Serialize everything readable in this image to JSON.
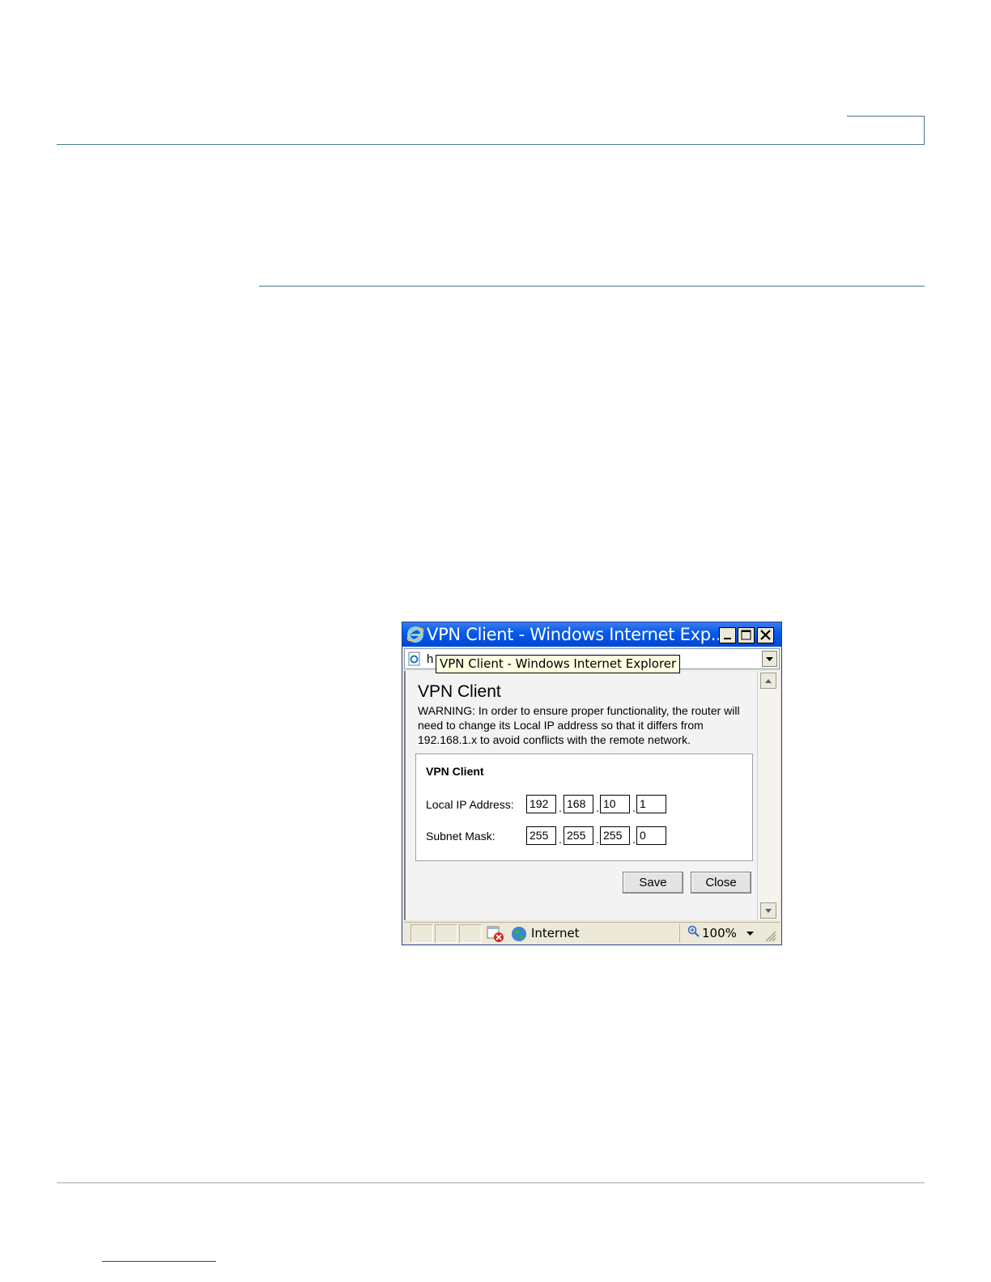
{
  "window": {
    "title": "VPN Client - Windows Internet Exp...",
    "tooltip": "VPN Client - Windows Internet Explorer",
    "address_prefix": "h"
  },
  "page": {
    "heading": "VPN Client",
    "warning": "WARNING: In order to ensure proper functionality, the router will need to change its Local IP address so that it differs from 192.168.1.x to avoid conflicts with the remote network."
  },
  "panel": {
    "title": "VPN Client",
    "local_ip_label": "Local IP Address:",
    "local_ip": [
      "192",
      "168",
      "10",
      "1"
    ],
    "subnet_label": "Subnet Mask:",
    "subnet": [
      "255",
      "255",
      "255",
      "0"
    ]
  },
  "buttons": {
    "save": "Save",
    "close": "Close"
  },
  "status": {
    "zone": "Internet",
    "zoom": "100%"
  },
  "icons": {
    "app": "internet-explorer-icon",
    "page": "page-icon",
    "blocked": "popup-blocked-icon",
    "zone": "globe-icon",
    "zoom": "magnifier-icon"
  }
}
